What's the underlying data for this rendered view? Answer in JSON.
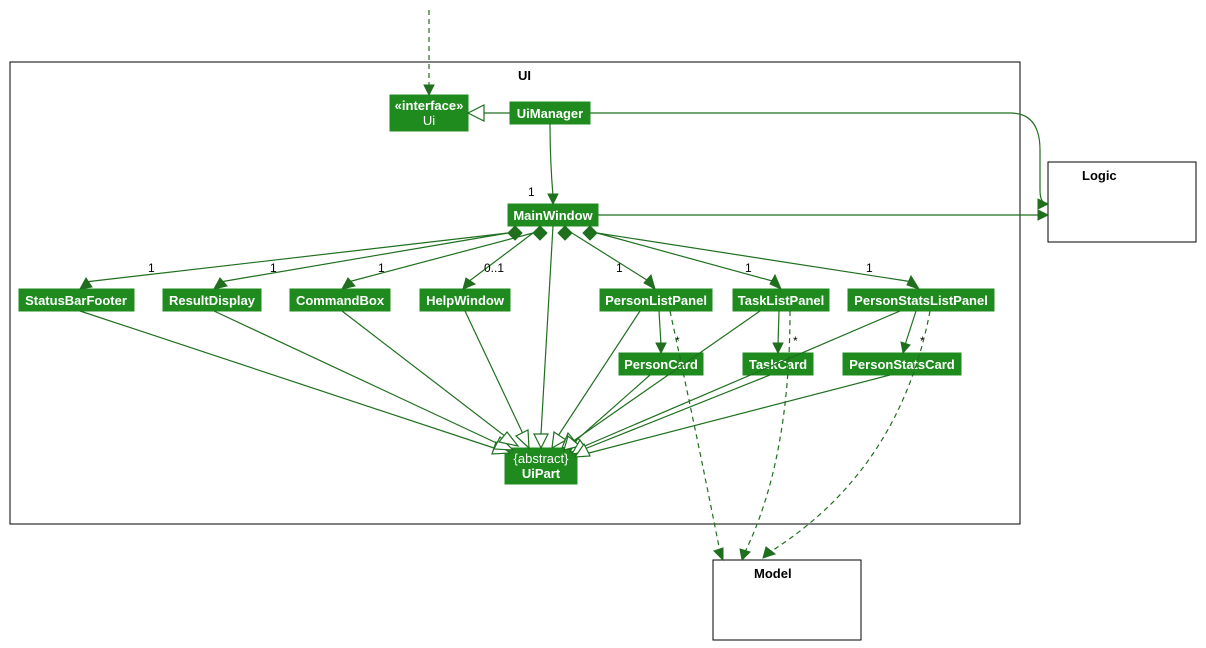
{
  "packages": {
    "ui": {
      "label": "UI"
    },
    "logic": {
      "label": "Logic"
    },
    "model": {
      "label": "Model"
    }
  },
  "nodes": {
    "uiInterface": {
      "stereotype": "«interface»",
      "name": "Ui"
    },
    "uiManager": {
      "name": "UiManager"
    },
    "mainWindow": {
      "name": "MainWindow"
    },
    "statusBarFooter": {
      "name": "StatusBarFooter"
    },
    "resultDisplay": {
      "name": "ResultDisplay"
    },
    "commandBox": {
      "name": "CommandBox"
    },
    "helpWindow": {
      "name": "HelpWindow"
    },
    "personListPanel": {
      "name": "PersonListPanel"
    },
    "taskListPanel": {
      "name": "TaskListPanel"
    },
    "personStatsListPanel": {
      "name": "PersonStatsListPanel"
    },
    "personCard": {
      "name": "PersonCard"
    },
    "taskCard": {
      "name": "TaskCard"
    },
    "personStatsCard": {
      "name": "PersonStatsCard"
    },
    "uiPart": {
      "stereotype": "{abstract}",
      "name": "UiPart"
    }
  },
  "multiplicities": {
    "mainWindow": "1",
    "statusBarFooter": "1",
    "resultDisplay": "1",
    "commandBox": "1",
    "helpWindow": "0..1",
    "personListPanel": "1",
    "taskListPanel": "1",
    "personStatsListPanel": "1",
    "personCard": "*",
    "taskCard": "*",
    "personStatsCard": "*"
  },
  "colors": {
    "nodeFill": "#1f8b1f",
    "edge": "#1f6f1f"
  }
}
